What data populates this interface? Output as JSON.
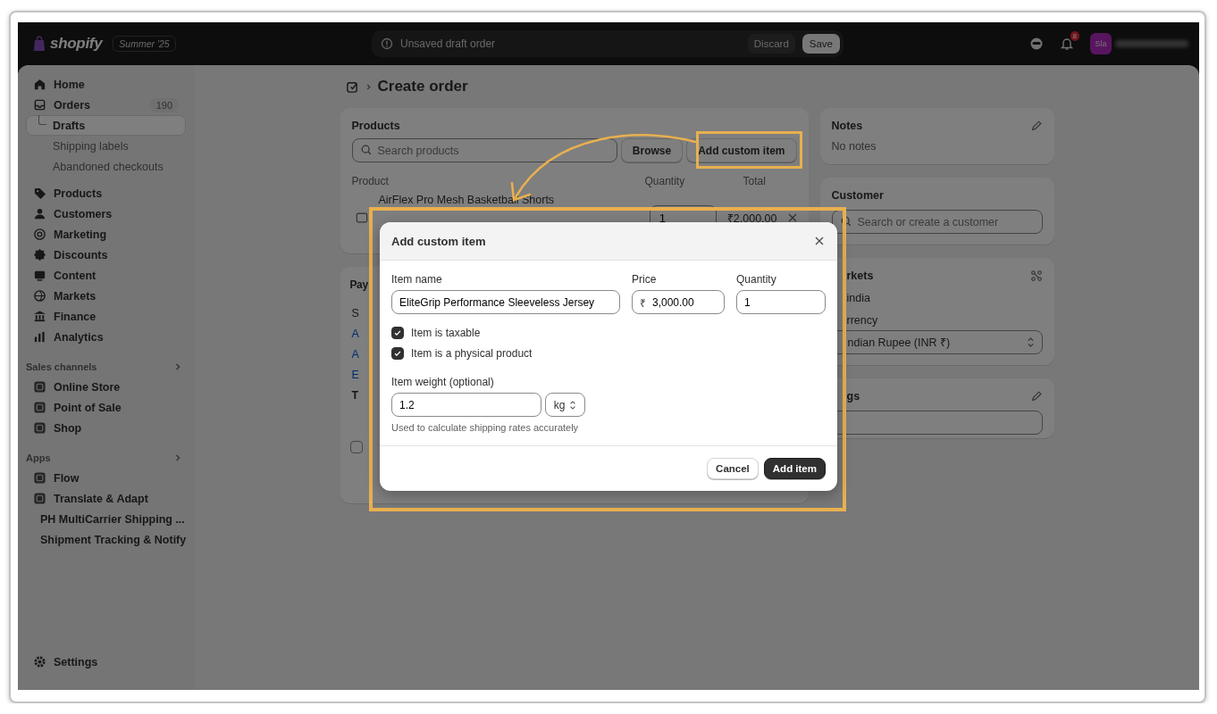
{
  "topbar": {
    "logo": "shopify",
    "edition": "Summer '25",
    "status": "Unsaved draft order",
    "discard": "Discard",
    "save": "Save",
    "notifications": "8",
    "avatar": "Sla"
  },
  "sidebar": {
    "nav": [
      {
        "label": "Home",
        "selected": false
      },
      {
        "label": "Orders",
        "count": "190",
        "selected": false,
        "children": [
          {
            "label": "Drafts",
            "selected": true
          },
          {
            "label": "Shipping labels",
            "selected": false
          },
          {
            "label": "Abandoned checkouts",
            "selected": false
          }
        ]
      },
      {
        "label": "Products",
        "selected": false
      },
      {
        "label": "Customers",
        "selected": false
      },
      {
        "label": "Marketing",
        "selected": false
      },
      {
        "label": "Discounts",
        "selected": false
      },
      {
        "label": "Content",
        "selected": false
      },
      {
        "label": "Markets",
        "selected": false
      },
      {
        "label": "Finance",
        "selected": false
      },
      {
        "label": "Analytics",
        "selected": false
      }
    ],
    "sections": [
      {
        "title": "Sales channels",
        "items": [
          {
            "label": "Online Store",
            "selected": false
          },
          {
            "label": "Point of Sale",
            "selected": false
          },
          {
            "label": "Shop",
            "selected": false
          }
        ]
      },
      {
        "title": "Apps",
        "items": [
          {
            "label": "Flow",
            "selected": false
          },
          {
            "label": "Translate & Adapt",
            "selected": false
          },
          {
            "label": "PH MultiCarrier Shipping ...",
            "selected": false
          },
          {
            "label": "Shipment Tracking & Notify",
            "selected": false
          }
        ]
      }
    ],
    "settings": {
      "label": "Settings",
      "selected": false
    }
  },
  "page": {
    "title": "Create order"
  },
  "products_card": {
    "title": "Products",
    "search_placeholder": "Search products",
    "browse": "Browse",
    "add_custom": "Add custom item",
    "columns": [
      "Product",
      "Quantity",
      "Total"
    ],
    "rows": [
      {
        "name": "AirFlex Pro Mesh Basketball Shorts",
        "quantity": "1",
        "total": "₹2,000.00"
      }
    ]
  },
  "payment_card": {
    "title": "Pay",
    "lines": [
      {
        "text": "S",
        "kind": "plain"
      },
      {
        "text": "A",
        "kind": "link"
      },
      {
        "text": "A",
        "kind": "link"
      },
      {
        "text": "E",
        "kind": "link"
      },
      {
        "text": "T",
        "kind": "bold"
      }
    ],
    "checkbox": {
      "checked": false
    }
  },
  "notes": {
    "title": "Notes",
    "text": "No notes"
  },
  "customer": {
    "title": "Customer",
    "placeholder": "Search or create a customer"
  },
  "markets": {
    "title": "rkets",
    "market": "india",
    "currency_label": "rrency",
    "currency": "ndian Rupee (INR ₹)"
  },
  "tags": {
    "title": "gs"
  },
  "modal": {
    "title": "Add custom item",
    "fields": [
      {
        "label": "Item name",
        "value": "EliteGrip Performance Sleeveless Jersey"
      },
      {
        "label": "Price",
        "prefix": "₹",
        "value": "3,000.00"
      },
      {
        "label": "Quantity",
        "value": "1"
      }
    ],
    "checkboxes": [
      {
        "label": "Item is taxable",
        "checked": true
      },
      {
        "label": "Item is a physical product",
        "checked": true
      }
    ],
    "weight": {
      "label": "Item weight (optional)",
      "value": "1.2",
      "unit": "kg",
      "help": "Used to calculate shipping rates accurately"
    },
    "cancel": "Cancel",
    "submit": "Add item"
  }
}
